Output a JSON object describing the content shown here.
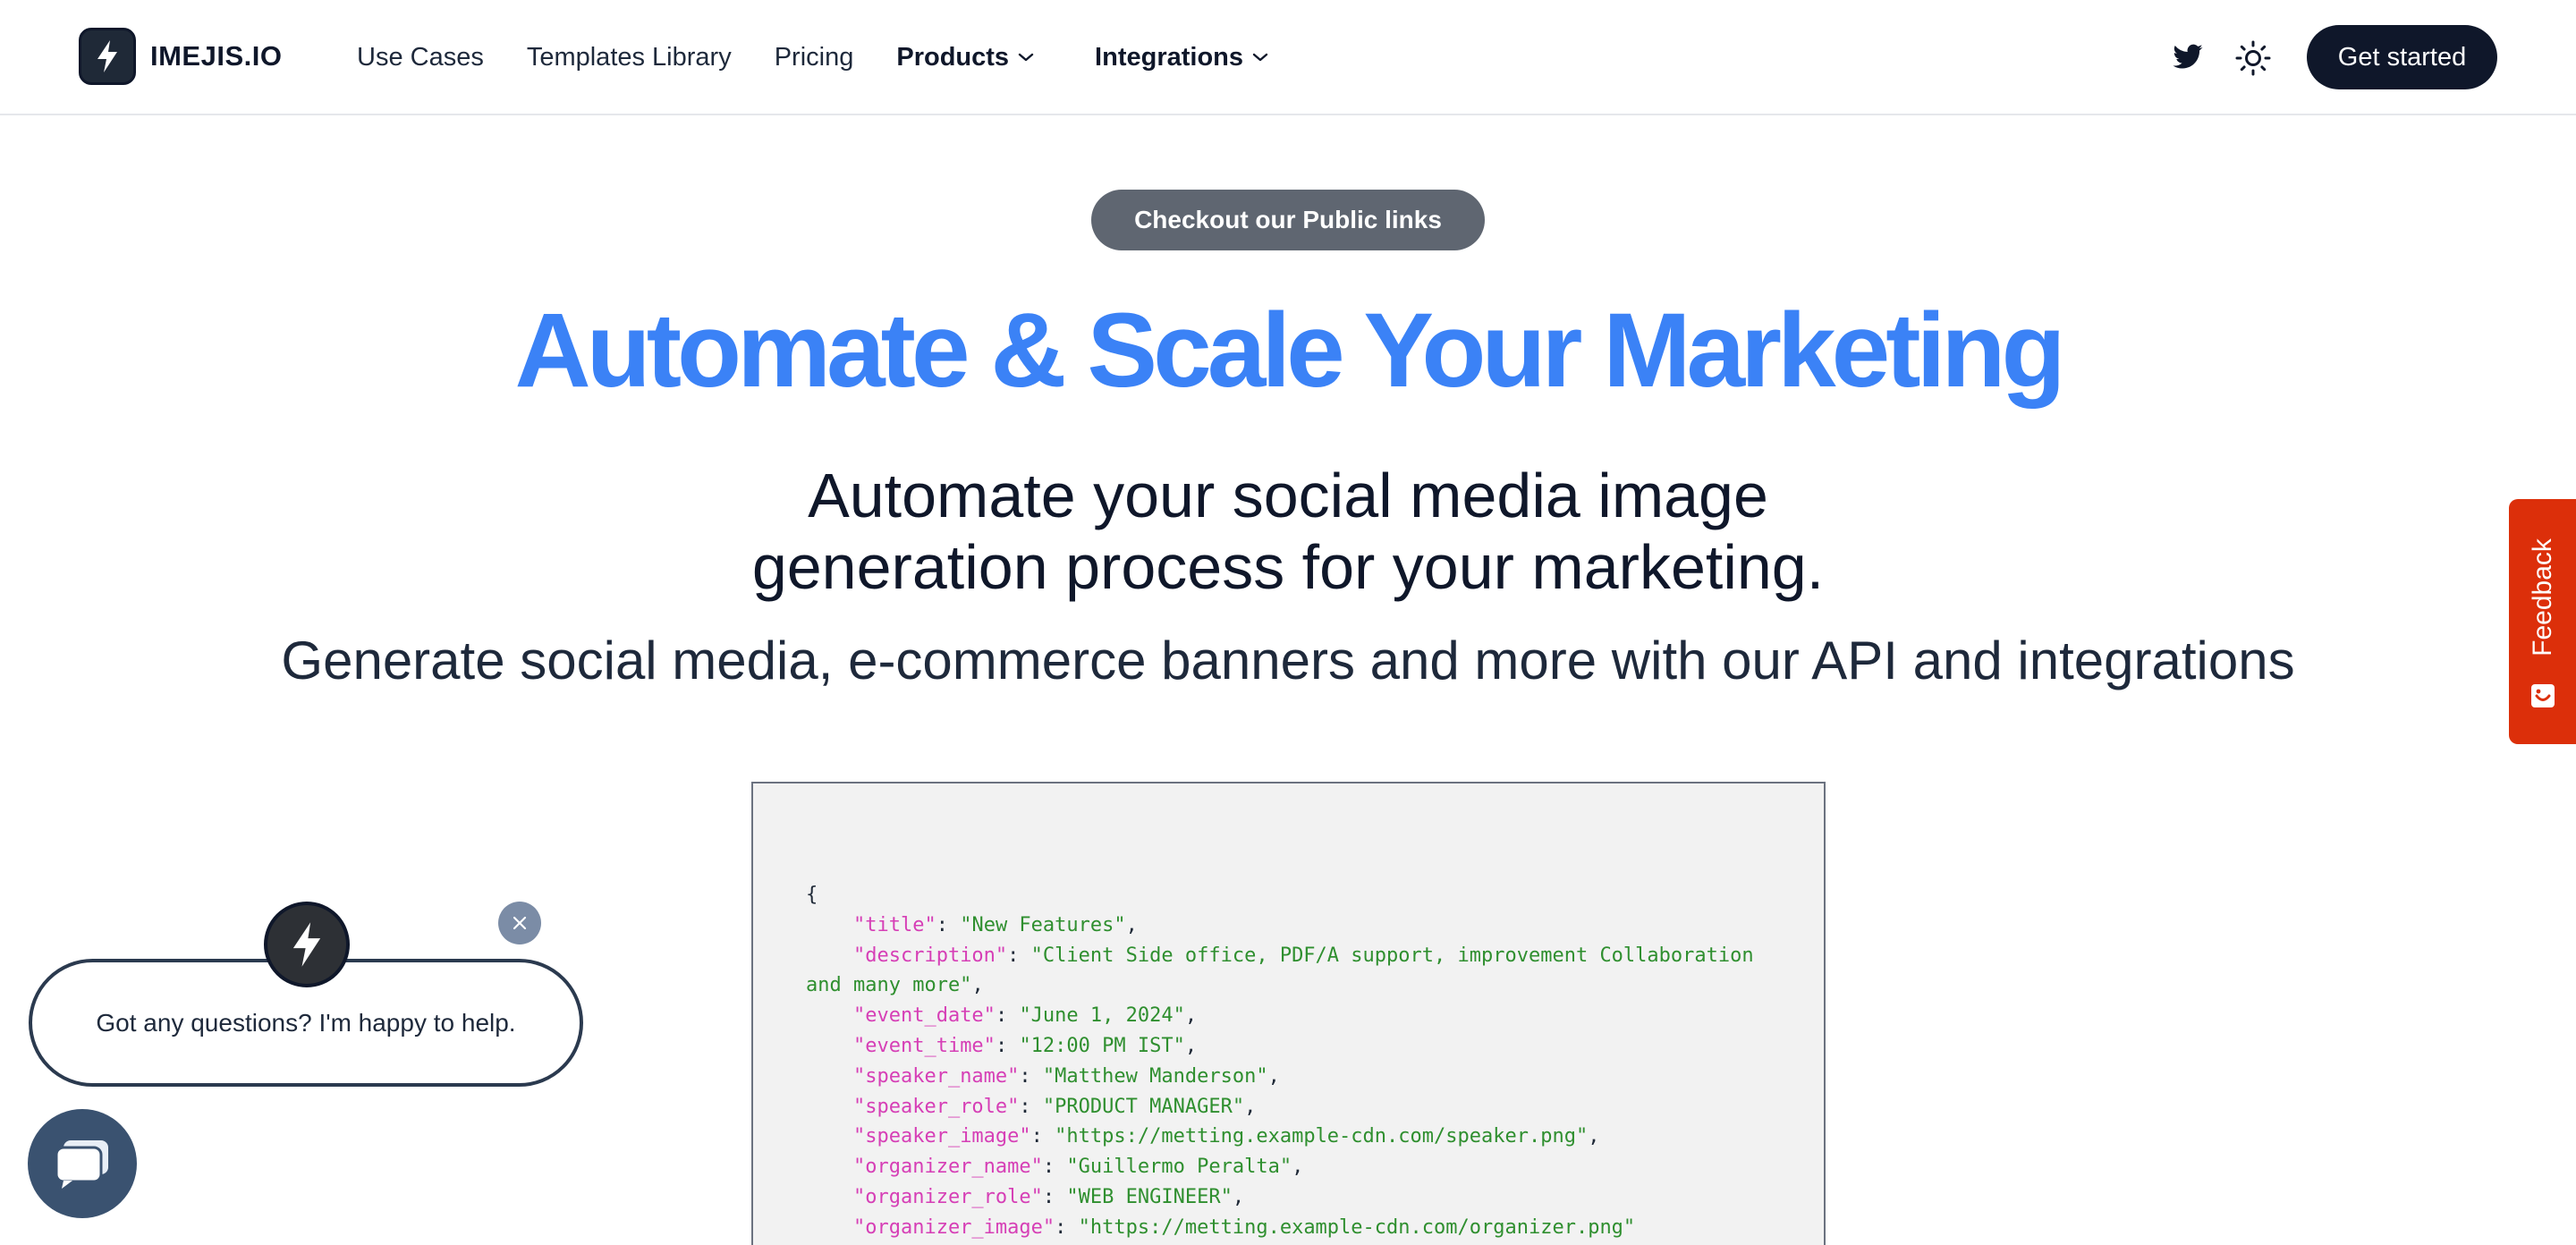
{
  "brand": {
    "name": "IMEJIS.IO"
  },
  "nav": {
    "use_cases": "Use Cases",
    "templates": "Templates Library",
    "pricing": "Pricing",
    "products": "Products",
    "integrations": "Integrations"
  },
  "header": {
    "cta": "Get started"
  },
  "hero": {
    "pill": "Checkout our Public links",
    "title": "Automate & Scale Your Marketing",
    "subtitle_line1": "Automate your social media image",
    "subtitle_line2": "generation process for your marketing.",
    "description": "Generate social media, e-commerce banners and more with our API and integrations"
  },
  "code_sample": {
    "fields": [
      {
        "key": "\"title\"",
        "value": "\"New Features\""
      },
      {
        "key": "\"description\"",
        "value": "\"Client Side office, PDF/A support, improvement Collaboration"
      },
      {
        "key": "",
        "value": "and many more\""
      },
      {
        "key": "\"event_date\"",
        "value": "\"June 1, 2024\""
      },
      {
        "key": "\"event_time\"",
        "value": "\"12:00 PM IST\""
      },
      {
        "key": "\"speaker_name\"",
        "value": "\"Matthew Manderson\""
      },
      {
        "key": "\"speaker_role\"",
        "value": "\"PRODUCT MANAGER\""
      },
      {
        "key": "\"speaker_image\"",
        "value": "\"https://metting.example-cdn.com/speaker.png\""
      },
      {
        "key": "\"organizer_name\"",
        "value": "\"Guillermo Peralta\""
      },
      {
        "key": "\"organizer_role\"",
        "value": "\"WEB ENGINEER\""
      },
      {
        "key": "\"organizer_image\"",
        "value": "\"https://metting.example-cdn.com/organizer.png\""
      }
    ]
  },
  "feedback": {
    "label": "Feedback"
  },
  "chat": {
    "message": "Got any questions? I'm happy to help."
  },
  "icons": {
    "logo": "lightning-bolt-icon",
    "twitter": "twitter-icon",
    "theme": "sun-icon",
    "chevron": "chevron-down-icon",
    "close": "close-icon",
    "chat": "chat-bubbles-icon",
    "feedback": "smiley-icon"
  },
  "colors": {
    "accent": "#3b82f6",
    "dark": "#0f172a",
    "pill": "#5f6671",
    "feedback": "#dc2f0a",
    "code_key": "#d63fb6",
    "code_string": "#2f8f2f"
  }
}
